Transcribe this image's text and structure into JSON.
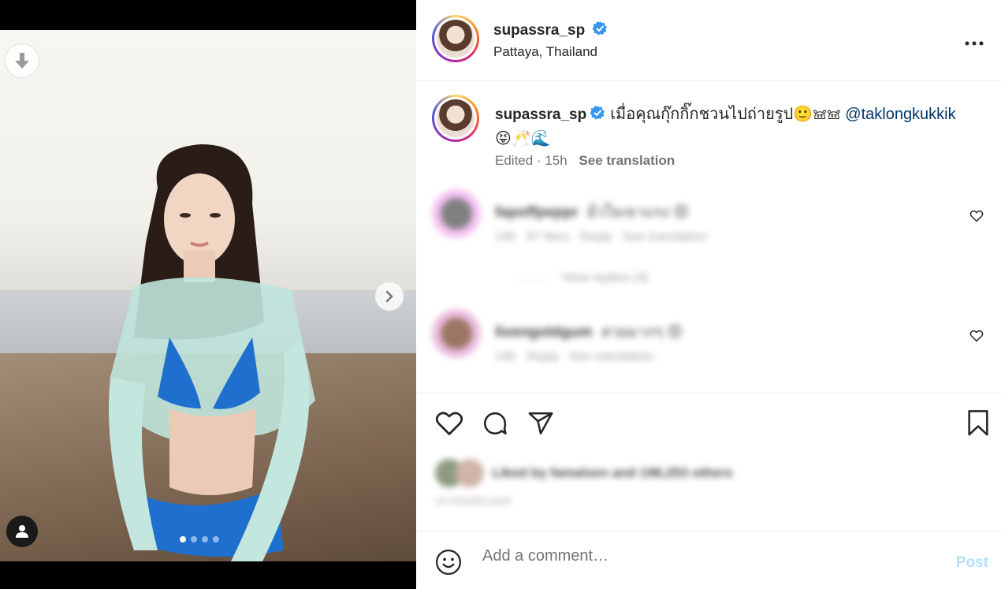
{
  "post": {
    "username": "supassra_sp",
    "location": "Pattaya, Thailand",
    "verified": true,
    "caption_text": "เมื่อคุณกุ๊กกิ๊กชวนไปถ่ายรูป🙂𖠌𖠌",
    "caption_mention": "@taklongkukkik",
    "caption_emojis": "😝🥂🌊",
    "edited_label": "Edited",
    "time_label": "15h",
    "see_translation": "See translation"
  },
  "comments": [
    {
      "username": "fapoffpeppr",
      "text": "ยั่วใจเขาแรง 😍",
      "time": "14h",
      "likes": "87 likes",
      "reply": "Reply",
      "see_translation": "See translation",
      "view_replies": "View replies (4)"
    },
    {
      "username": "livengoldgum",
      "text": "สวยมากๆ 😍",
      "time": "14h",
      "reply": "Reply",
      "see_translation": "See translation"
    }
  ],
  "likes": {
    "text": "Liked by famalsen and 198,253 others"
  },
  "time_ago": "14 HOURS AGO",
  "comment_box": {
    "placeholder": "Add a comment…",
    "post_label": "Post"
  },
  "colors": {
    "verified": "#3897f0",
    "mention": "#00376b",
    "post_disabled": "#b2dffc"
  },
  "carousel": {
    "count": 4,
    "active": 0
  }
}
